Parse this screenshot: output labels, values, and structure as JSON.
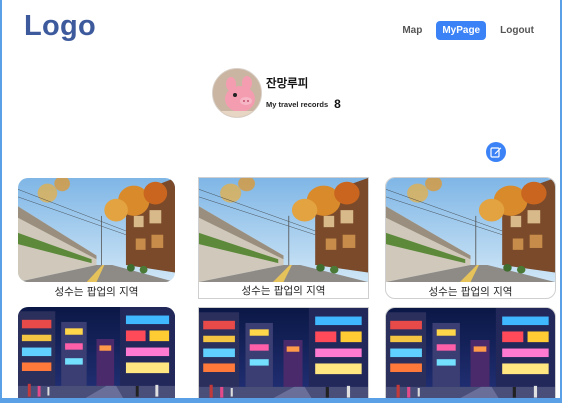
{
  "header": {
    "logo": "Logo",
    "nav": [
      {
        "label": "Map"
      },
      {
        "label": "MyPage"
      },
      {
        "label": "Logout"
      }
    ]
  },
  "profile": {
    "name": "잔망루피",
    "records_label": "My travel records",
    "records_count": "8"
  },
  "posts": [
    {
      "caption": "성수는 팝업의 지역",
      "photo": "village-street-autumn"
    },
    {
      "caption": "성수는 팝업의 지역",
      "photo": "village-street-autumn"
    },
    {
      "caption": "성수는 팝업의 지역",
      "photo": "village-street-autumn"
    },
    {
      "caption": "",
      "photo": "city-night-street"
    },
    {
      "caption": "",
      "photo": "city-night-street"
    },
    {
      "caption": "",
      "photo": "city-night-street"
    }
  ],
  "colors": {
    "accent": "#3b82f6",
    "logo": "#3d5a9c"
  }
}
